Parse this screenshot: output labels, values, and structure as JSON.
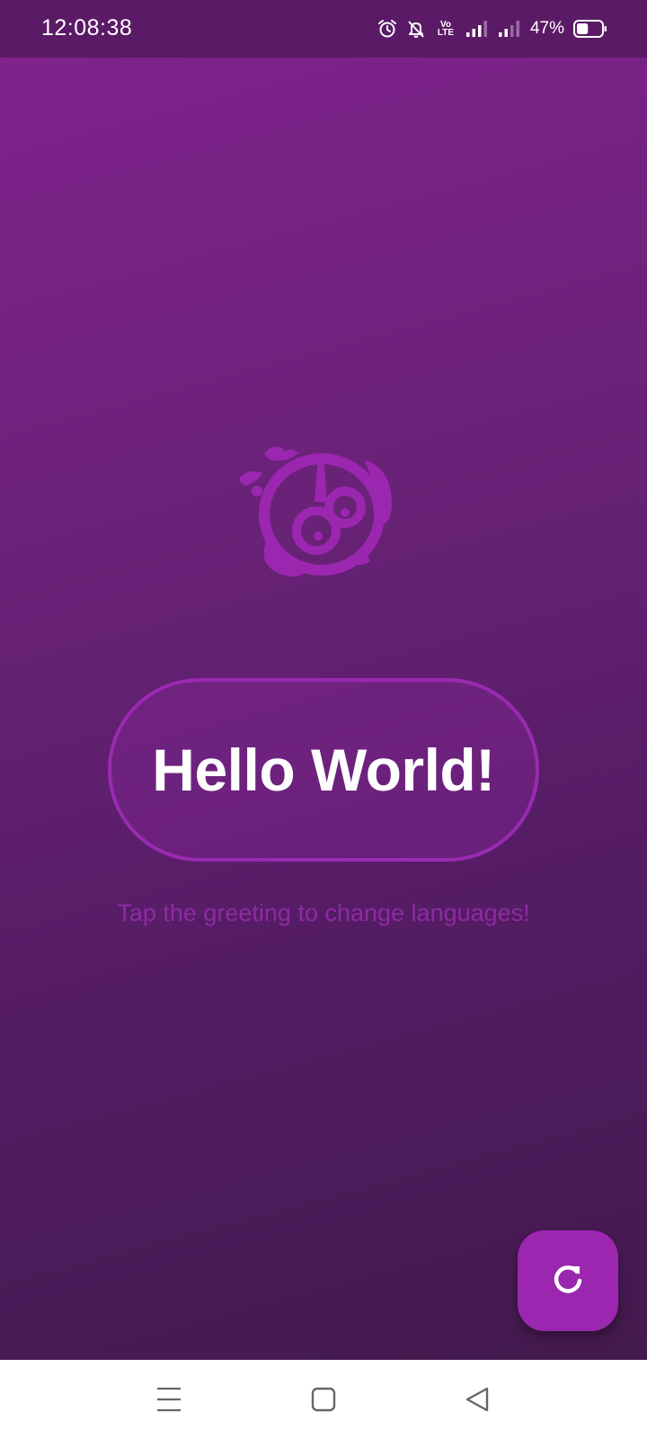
{
  "status_bar": {
    "time": "12:08:38",
    "volte_line1": "Vo",
    "volte_line2": "LTE",
    "battery_percent": "47%",
    "battery_level": 0.47,
    "icons": [
      "alarm-icon",
      "bell-off-icon",
      "volte-icon",
      "signal-icon",
      "signal-icon",
      "battery-icon"
    ]
  },
  "main": {
    "logo_icon": "flutter-bird-logo",
    "greeting": "Hello World!",
    "hint": "Tap the greeting to change languages!"
  },
  "fab": {
    "icon": "refresh-icon"
  },
  "nav_bar": {
    "icons": [
      "menu-icon",
      "home-icon",
      "back-icon"
    ]
  },
  "colors": {
    "accent": "#9b27b0",
    "background_top": "#82228f",
    "background_bottom": "#41194a",
    "status_bar": "#5b1a66",
    "hint": "#8e2aa3"
  }
}
